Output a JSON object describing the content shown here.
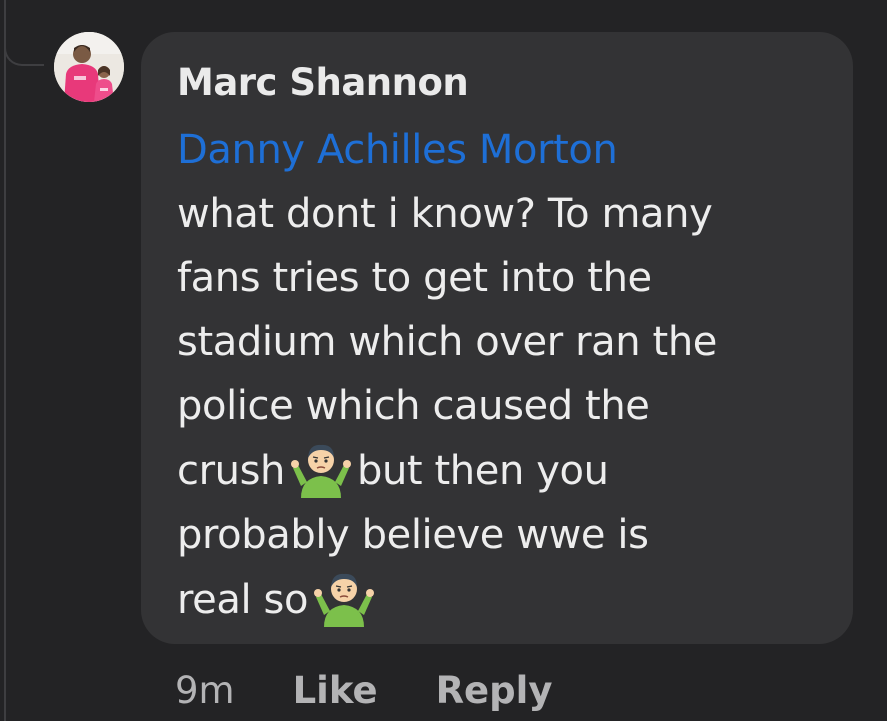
{
  "comment": {
    "author": "Marc Shannon",
    "mention": "Danny Achilles Morton",
    "lines": [
      "what dont i know? To many",
      "fans tries to get into the",
      "stadium which over ran the",
      "police which caused the",
      "crush",
      "but then you",
      "probably believe wwe is",
      "real so"
    ],
    "emoji": "man-shrugging-emoji"
  },
  "actions": {
    "timestamp": "9m",
    "like_label": "Like",
    "reply_label": "Reply"
  },
  "colors": {
    "background": "#232325",
    "bubble": "#333335",
    "mention": "#1e6fd6",
    "text": "#ededed",
    "meta": "#b3b3b5"
  }
}
